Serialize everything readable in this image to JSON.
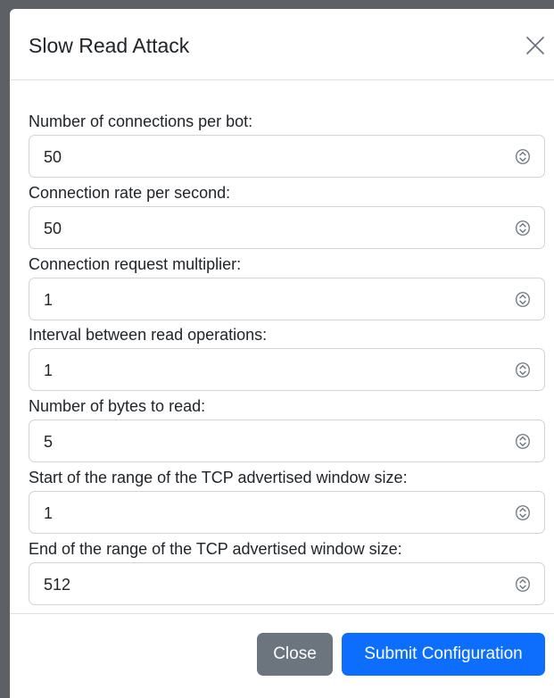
{
  "modal": {
    "title": "Slow Read Attack",
    "close_icon": "close-icon"
  },
  "fields": [
    {
      "label": "Number of connections per bot:",
      "value": "50"
    },
    {
      "label": "Connection rate per second:",
      "value": "50"
    },
    {
      "label": "Connection request multiplier:",
      "value": "1"
    },
    {
      "label": "Interval between read operations:",
      "value": "1"
    },
    {
      "label": "Number of bytes to read:",
      "value": "5"
    },
    {
      "label": "Start of the range of the TCP advertised window size:",
      "value": "1"
    },
    {
      "label": "End of the range of the TCP advertised window size:",
      "value": "512"
    }
  ],
  "footer": {
    "close_label": "Close",
    "submit_label": "Submit Configuration"
  },
  "colors": {
    "primary": "#0d6efd",
    "secondary": "#6c757d"
  }
}
